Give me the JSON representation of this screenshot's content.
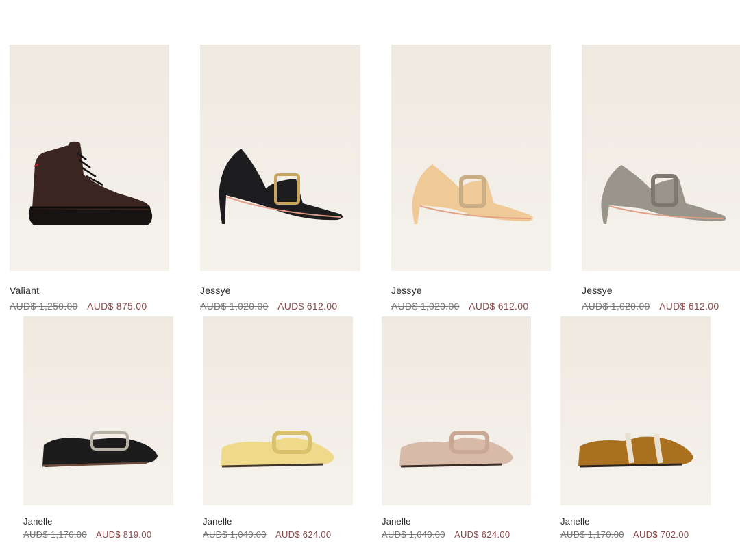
{
  "products": [
    {
      "name": "Valiant",
      "original_price": "AUD$ 1,250.00",
      "sale_price": "AUD$ 875.00",
      "shoe_icon": "lace-up-boot-icon",
      "color": "#3a2520"
    },
    {
      "name": "Jessye",
      "original_price": "AUD$ 1,020.00",
      "sale_price": "AUD$ 612.00",
      "shoe_icon": "buckle-pump-icon",
      "color": "#1d1d1f"
    },
    {
      "name": "Jessye",
      "original_price": "AUD$ 1,020.00",
      "sale_price": "AUD$ 612.00",
      "shoe_icon": "buckle-pump-icon",
      "color": "#efc996"
    },
    {
      "name": "Jessye",
      "original_price": "AUD$ 1,020.00",
      "sale_price": "AUD$ 612.00",
      "shoe_icon": "buckle-pump-icon",
      "color": "#9a958b"
    },
    {
      "name": "Janelle",
      "original_price": "AUD$ 1,170.00",
      "sale_price": "AUD$ 819.00",
      "shoe_icon": "buckle-loafer-icon",
      "color": "#1c1c1c"
    },
    {
      "name": "Janelle",
      "original_price": "AUD$ 1,040.00",
      "sale_price": "AUD$ 624.00",
      "shoe_icon": "buckle-loafer-icon",
      "color": "#efd98a"
    },
    {
      "name": "Janelle",
      "original_price": "AUD$ 1,040.00",
      "sale_price": "AUD$ 624.00",
      "shoe_icon": "buckle-loafer-icon",
      "color": "#d7bba8"
    },
    {
      "name": "Janelle",
      "original_price": "AUD$ 1,170.00",
      "sale_price": "AUD$ 702.00",
      "shoe_icon": "buckle-loafer-icon",
      "color": "#a8701f"
    }
  ],
  "colors": {
    "sale_price": "#8a4a4a",
    "original_price": "#777777",
    "image_background": "#f0ebe3"
  }
}
